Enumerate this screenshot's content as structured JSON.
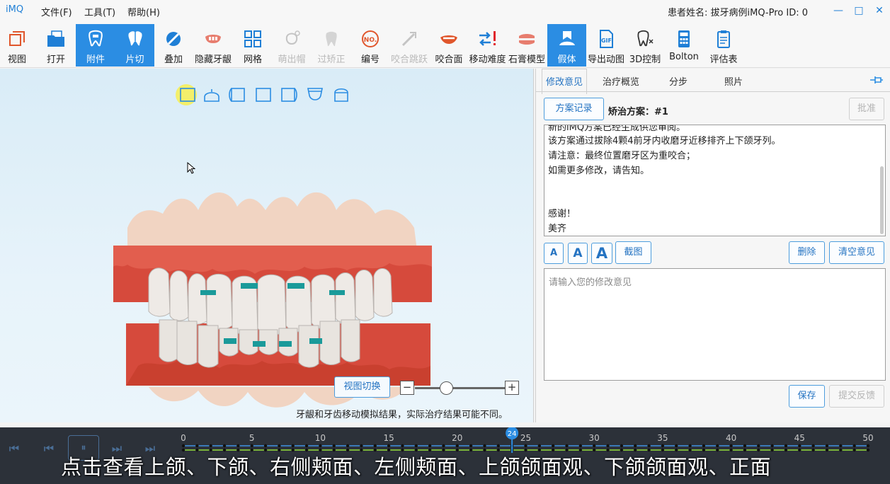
{
  "app": {
    "logo": "iMQ"
  },
  "menu": [
    {
      "label": "文件(F)"
    },
    {
      "label": "工具(T)"
    },
    {
      "label": "帮助(H)"
    }
  ],
  "patient_info": "患者姓名: 拔牙病例iMQ-Pro ID: 0",
  "window_controls": {
    "minimize": "—",
    "maximize": "□",
    "close": "✕"
  },
  "toolbar": {
    "tools": [
      {
        "label": "视图",
        "icon": "view-cube-icon",
        "state": "normal"
      },
      {
        "label": "打开",
        "icon": "folder-open-icon",
        "state": "normal"
      },
      {
        "label": "附件",
        "icon": "attachment-tooth-icon",
        "state": "active"
      },
      {
        "label": "片切",
        "icon": "ipr-tooth-icon",
        "state": "active"
      },
      {
        "label": "叠加",
        "icon": "overlay-icon",
        "state": "normal"
      },
      {
        "label": "隐藏牙龈",
        "icon": "hide-gum-icon",
        "state": "normal"
      },
      {
        "label": "网格",
        "icon": "grid-icon",
        "state": "normal"
      },
      {
        "label": "萌出帽",
        "icon": "eruption-cap-icon",
        "state": "disabled"
      },
      {
        "label": "过矫正",
        "icon": "overcorrection-icon",
        "state": "disabled"
      },
      {
        "label": "编号",
        "icon": "numbering-icon",
        "state": "normal"
      },
      {
        "label": "咬合跳跃",
        "icon": "bite-jump-icon",
        "state": "disabled"
      },
      {
        "label": "咬合面",
        "icon": "occlusal-icon",
        "state": "normal"
      },
      {
        "label": "移动难度",
        "icon": "movement-difficulty-icon",
        "state": "normal"
      },
      {
        "label": "石膏模型",
        "icon": "plaster-model-icon",
        "state": "normal"
      },
      {
        "label": "假体",
        "icon": "prosthesis-icon",
        "state": "active"
      },
      {
        "label": "导出动图",
        "icon": "gif-export-icon",
        "state": "normal"
      },
      {
        "label": "3D控制",
        "icon": "3d-control-icon",
        "state": "normal"
      },
      {
        "label": "Bolton",
        "icon": "calculator-icon",
        "state": "normal"
      },
      {
        "label": "评估表",
        "icon": "clipboard-icon",
        "state": "normal"
      }
    ]
  },
  "viewport": {
    "view_icons": [
      "upper-jaw-view-icon",
      "lower-jaw-view-icon",
      "right-buccal-view-icon",
      "front-view-icon",
      "left-buccal-view-icon",
      "upper-occlusal-view-icon",
      "lower-occlusal-view-icon"
    ],
    "switch_button": "视图切换",
    "zoom": {
      "minus": "−",
      "plus": "+",
      "level": 0.35
    },
    "disclaimer": "牙龈和牙齿移动模拟结果，实际治疗结果可能不同。"
  },
  "panel": {
    "tabs": [
      {
        "label": "修改意见"
      },
      {
        "label": "治疗概览"
      },
      {
        "label": "分步"
      },
      {
        "label": "照片"
      }
    ],
    "record_button": "方案记录",
    "plan_label": "矫治方案：#1",
    "approve_button": "批准",
    "notes": [
      "新的iMQ方案已经生成供您审阅。",
      "该方案通过拔除4颗4前牙内收磨牙近移排齐上下颌牙列。",
      "请注意：最终位置磨牙区为重咬合；",
      "如需更多修改，请告知。",
      "",
      "",
      "感谢！",
      "美齐"
    ],
    "font_small": "A",
    "font_medium": "A",
    "font_large": "A",
    "screenshot_button": "截图",
    "delete_button": "删除",
    "clear_button": "清空意见",
    "input_placeholder": "请输入您的修改意见",
    "save_button": "保存",
    "submit_button": "提交反馈"
  },
  "timeline": {
    "controls": {
      "first": "⏮",
      "prev": "⏮",
      "pause": "⏸",
      "next": "⏭",
      "last": "⏭"
    },
    "ticks": [
      0,
      5,
      10,
      15,
      20,
      25,
      30,
      35,
      40,
      45,
      50
    ],
    "current_step": 24,
    "max_step": 50
  },
  "subtitle": "点击查看上颌、下颌、右侧颊面、左侧颊面、上颌颌面观、下颌颌面观、正面"
}
